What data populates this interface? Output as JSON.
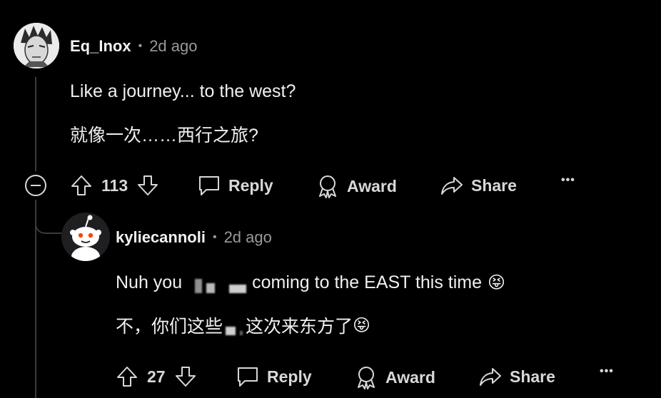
{
  "comment": {
    "username": "Eq_Inox",
    "time": "2d ago",
    "lines": [
      "Like a journey... to the west?",
      "就像一次……西行之旅?"
    ],
    "votes": "113",
    "actions": {
      "reply": "Reply",
      "award": "Award",
      "share": "Share",
      "more": "•••"
    }
  },
  "reply": {
    "username": "kyliecannoli",
    "time": "2d ago",
    "line1_start": "Nuh you",
    "line1_end": "coming to the EAST this time",
    "line2_start": "不，你们这些",
    "line2_end": "这次来东方了",
    "emoji": "😝",
    "votes": "27",
    "actions": {
      "reply": "Reply",
      "award": "Award",
      "share": "Share",
      "more": "•••"
    }
  },
  "colors": {
    "background": "#000000",
    "text": "#f0f0f0",
    "muted": "#9a9a9a",
    "thread_line": "#3a3a3a"
  }
}
